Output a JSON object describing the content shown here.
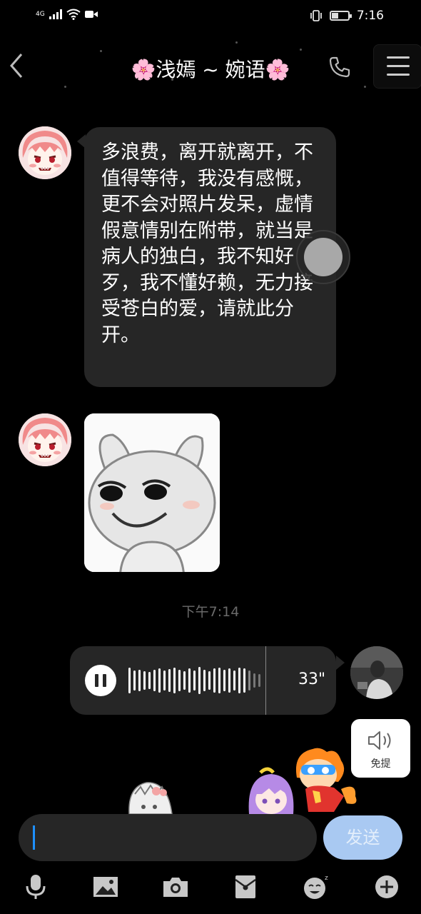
{
  "status_bar": {
    "network": "4G",
    "time": "7:16"
  },
  "header": {
    "title": "🌸浅嫣 ~ 婉语🌸"
  },
  "messages": {
    "text_message": "多浪费，离开就离开，不值得等待，我没有感慨，更不会对照片发呆，虚情假意情别在附带，就当是病人的独白，我不知好歹，我不懂好赖，无力接受苍白的爱，请就此分开。",
    "timestamp": "下午7:14",
    "voice_duration": "33\""
  },
  "speaker_toggle": {
    "label": "免提"
  },
  "composer": {
    "send_label": "发送"
  },
  "toolbar_icons": [
    "microphone-icon",
    "image-icon",
    "camera-icon",
    "red-packet-icon",
    "emoji-icon",
    "plus-icon"
  ],
  "colors": {
    "background": "#000000",
    "bubble": "#262626",
    "send_button": "#a9c9f2",
    "caret": "#1e90ff"
  }
}
